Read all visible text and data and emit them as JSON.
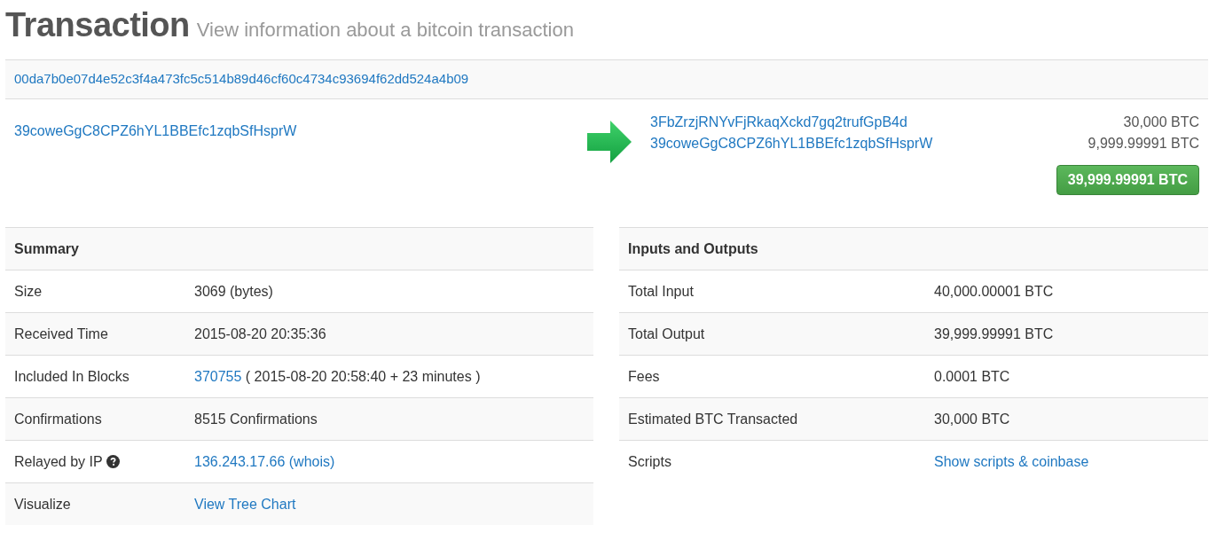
{
  "header": {
    "title": "Transaction",
    "subtitle": "View information about a bitcoin transaction"
  },
  "tx_hash": "00da7b0e07d4e52c3f4a473fc5c514b89d46cf60c4734c93694f62dd524a4b09",
  "inputs": [
    {
      "address": "39coweGgC8CPZ6hYL1BBEfc1zqbSfHsprW"
    }
  ],
  "outputs": [
    {
      "address": "3FbZrzjRNYvFjRkaqXckd7gq2trufGpB4d",
      "amount": "30,000 BTC"
    },
    {
      "address": "39coweGgC8CPZ6hYL1BBEfc1zqbSfHsprW",
      "amount": "9,999.99991 BTC"
    }
  ],
  "total_button": "39,999.99991 BTC",
  "summary": {
    "title": "Summary",
    "rows": [
      {
        "label": "Size",
        "kind": "text",
        "value": "3069 (bytes)"
      },
      {
        "label": "Received Time",
        "kind": "text",
        "value": "2015-08-20 20:35:36"
      },
      {
        "label": "Included In Blocks",
        "kind": "link_text",
        "link": "370755",
        "value": "( 2015-08-20 20:58:40 + 23 minutes )"
      },
      {
        "label": "Confirmations",
        "kind": "text",
        "value": "8515 Confirmations"
      },
      {
        "label": "Relayed by IP",
        "help": true,
        "kind": "link",
        "link": "136.243.17.66 (whois)"
      },
      {
        "label": "Visualize",
        "kind": "link",
        "link": "View Tree Chart"
      }
    ]
  },
  "inputs_outputs": {
    "title": "Inputs and Outputs",
    "rows": [
      {
        "label": "Total Input",
        "kind": "text",
        "value": "40,000.00001 BTC"
      },
      {
        "label": "Total Output",
        "kind": "text",
        "value": "39,999.99991 BTC"
      },
      {
        "label": "Fees",
        "kind": "text",
        "value": "0.0001 BTC"
      },
      {
        "label": "Estimated BTC Transacted",
        "kind": "text",
        "value": "30,000 BTC"
      },
      {
        "label": "Scripts",
        "kind": "link",
        "link": "Show scripts & coinbase"
      }
    ]
  }
}
